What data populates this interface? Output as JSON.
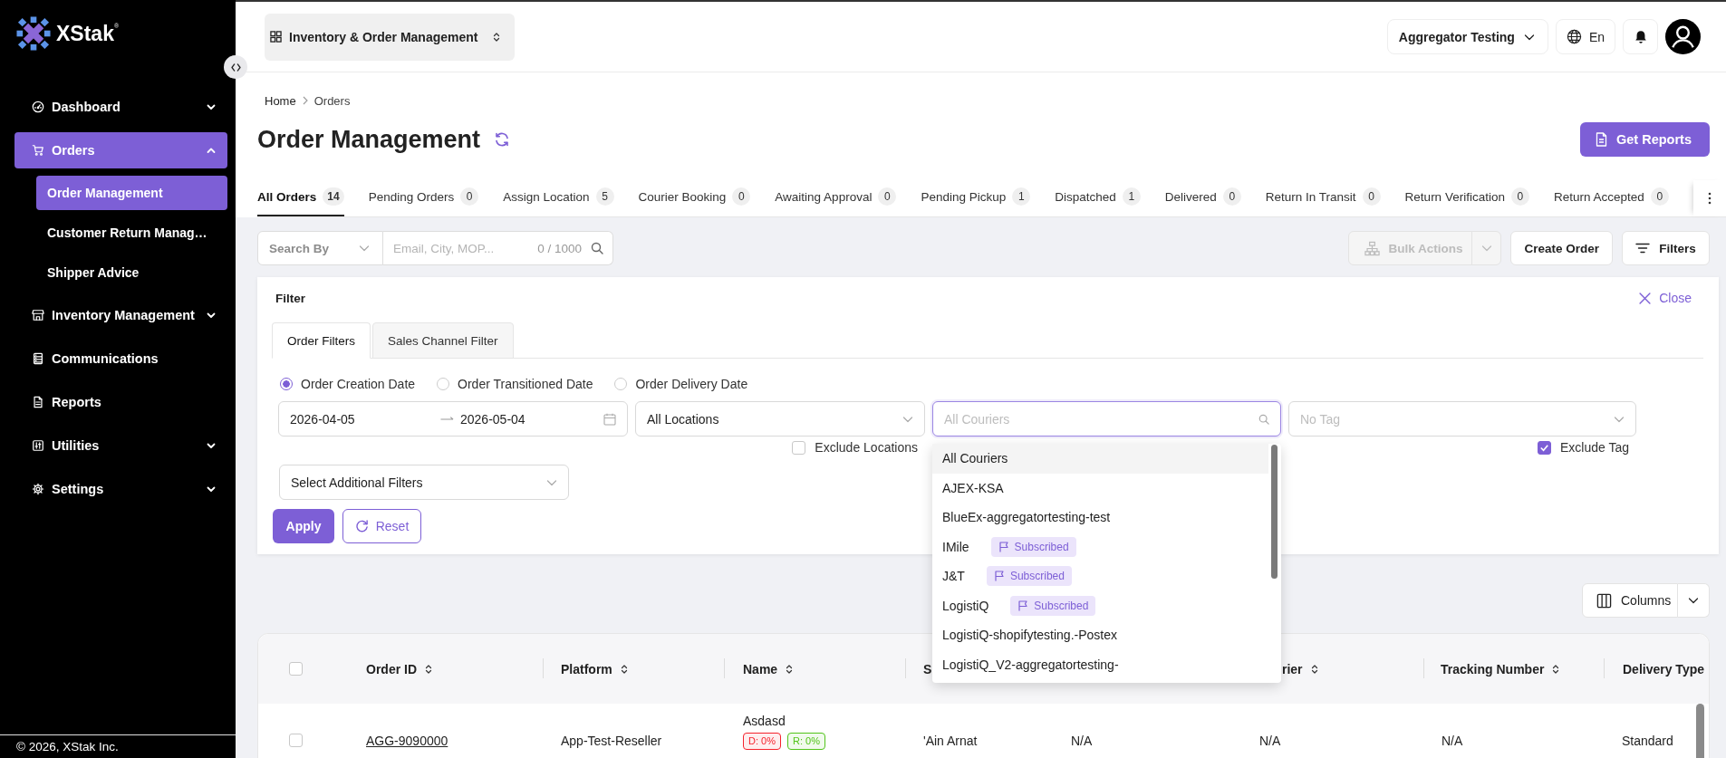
{
  "sidebar": {
    "logo": "XStak$^{®}$",
    "items": [
      {
        "label": "Dashboard",
        "selected": false,
        "expanded": false
      },
      {
        "label": "Orders",
        "selected": true,
        "expanded": true,
        "children": [
          {
            "label": "Order Management",
            "selected": true
          },
          {
            "label": "Customer Return Manag…",
            "selected": false
          },
          {
            "label": "Shipper Advice",
            "selected": false
          }
        ]
      },
      {
        "label": "Inventory Management",
        "selected": false,
        "expanded": false
      },
      {
        "label": "Communications",
        "selected": false
      },
      {
        "label": "Reports",
        "selected": false
      },
      {
        "label": "Utilities",
        "selected": false,
        "expanded": false
      },
      {
        "label": "Settings",
        "selected": false,
        "expanded": false
      }
    ],
    "footer": "© 2026, XStak Inc."
  },
  "top_bar": {
    "app_switcher": "Inventory & Order Management",
    "account": "Aggregator Testing",
    "language": "En"
  },
  "breadcrumb": [
    "Home",
    "Orders"
  ],
  "page_title": "Order Management",
  "get_reports_button": "Get Reports",
  "status_tabs": [
    {
      "label": "All Orders",
      "count": "14",
      "selected": true
    },
    {
      "label": "Pending Orders",
      "count": "0",
      "selected": false
    },
    {
      "label": "Assign Location",
      "count": "5",
      "selected": false
    },
    {
      "label": "Courier Booking",
      "count": "0",
      "selected": false
    },
    {
      "label": "Awaiting Approval",
      "count": "0",
      "selected": false
    },
    {
      "label": "Pending Pickup",
      "count": "1",
      "selected": false
    },
    {
      "label": "Dispatched",
      "count": "1",
      "selected": false
    },
    {
      "label": "Delivered",
      "count": "0",
      "selected": false
    },
    {
      "label": "Return In Transit",
      "count": "0",
      "selected": false
    },
    {
      "label": "Return Verification",
      "count": "0",
      "selected": false
    },
    {
      "label": "Return Accepted",
      "count": "0",
      "selected": false
    }
  ],
  "toolbar": {
    "search_by": {
      "placeholder": "Search By"
    },
    "search": {
      "placeholder": "Email, City, MOP...",
      "counter": "0 / 1000"
    },
    "bulk_actions": {
      "label": "Bulk Actions",
      "disabled": true
    },
    "create_order_button": "Create Order",
    "filters_button": "Filters"
  },
  "filter_panel": {
    "title": "Filter",
    "close": "Close",
    "tabs": [
      {
        "label": "Order Filters",
        "selected": true
      },
      {
        "label": "Sales Channel Filter",
        "selected": false
      }
    ],
    "date_types": [
      {
        "label": "Order Creation Date",
        "selected": true
      },
      {
        "label": "Order Transitioned Date",
        "selected": false
      },
      {
        "label": "Order Delivery Date",
        "selected": false
      }
    ],
    "date_range": {
      "start": "2026-04-05",
      "end": "2026-05-04"
    },
    "location": {
      "value": "All Locations",
      "exclude": {
        "label": "Exclude Locations",
        "checked": false
      }
    },
    "courier": {
      "placeholder": "All Couriers",
      "expanded": true,
      "options": [
        {
          "label": "All Couriers",
          "selected": true
        },
        {
          "label": "AJEX-KSA",
          "selected": false
        },
        {
          "label": "BlueEx-aggregatortesting-test",
          "selected": false
        },
        {
          "label": "IMile",
          "badge": "Subscribed",
          "selected": false
        },
        {
          "label": "J&T",
          "badge": "Subscribed",
          "selected": false
        },
        {
          "label": "LogistiQ",
          "badge": "Subscribed",
          "selected": false
        },
        {
          "label": "LogistiQ-shopifytesting.-Postex",
          "selected": false
        },
        {
          "label": "LogistiQ_V2-aggregatortesting-",
          "selected": false
        }
      ]
    },
    "tag": {
      "placeholder": "No Tag",
      "exclude": {
        "label": "Exclude Tag",
        "checked": true
      }
    },
    "additional_filters": {
      "value": "Select Additional Filters"
    },
    "apply_button": "Apply",
    "reset_button": "Reset"
  },
  "columns_button": "Columns",
  "table": {
    "header_checkbox": {
      "checked": false
    },
    "columns": [
      {
        "label": "Order ID",
        "sortable": true
      },
      {
        "label": "Platform",
        "sortable": true
      },
      {
        "label": "Name",
        "sortable": true
      },
      {
        "label": "S"
      },
      {},
      {
        "label": "rier",
        "sortable": true
      },
      {
        "label": "Tracking Number",
        "sortable": true
      },
      {
        "label": "Delivery Type",
        "sortable": false
      }
    ],
    "rows": [
      {
        "checked": false,
        "cells": [
          {
            "kind": "link",
            "text": "AGG-9090000"
          },
          {
            "kind": "text",
            "text": "App-Test-Reseller"
          },
          {
            "kind": "name",
            "text": "Asdasd",
            "tags": [
              {
                "label": "D: 0%",
                "color": "#f5222d"
              },
              {
                "label": "R: 0%",
                "color": "#52c41a"
              }
            ]
          },
          {
            "kind": "text",
            "text": "'Ain Arnat"
          },
          {
            "kind": "text",
            "text": "N/A"
          },
          {
            "kind": "text",
            "text": "N/A"
          },
          {
            "kind": "text",
            "text": "N/A"
          },
          {
            "kind": "text",
            "text": "Standard"
          }
        ]
      }
    ]
  }
}
